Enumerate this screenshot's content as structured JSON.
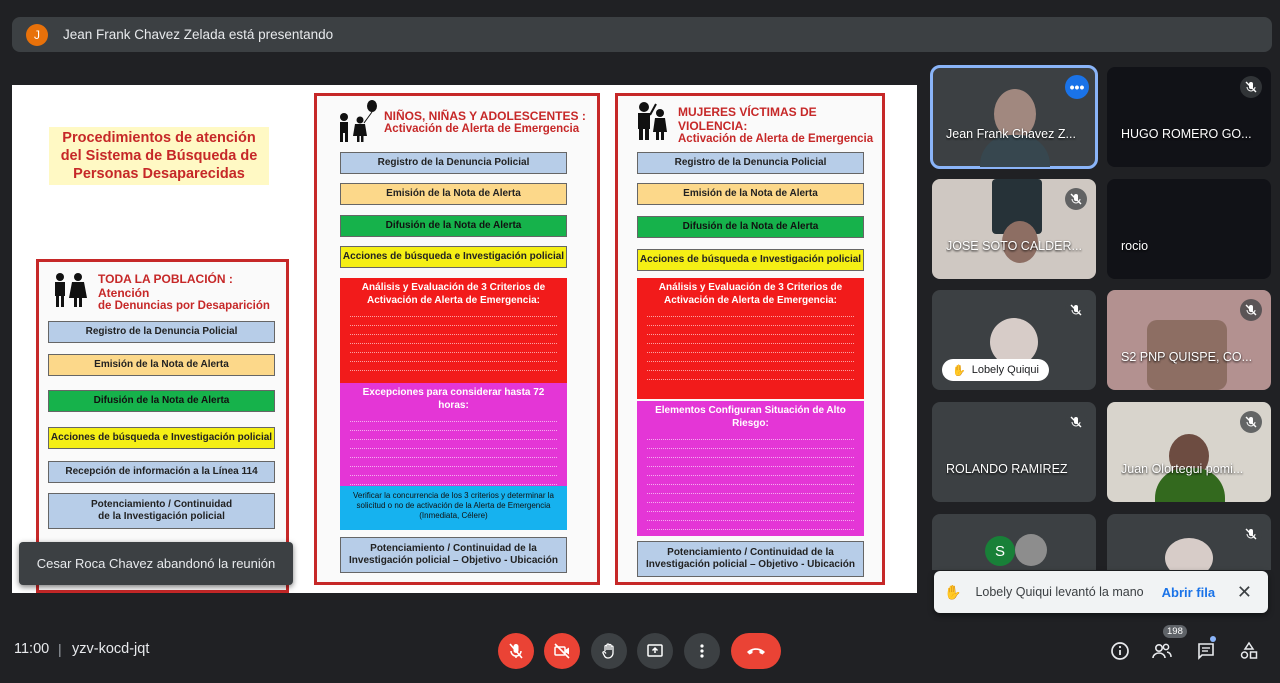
{
  "presenter": {
    "initial": "J",
    "text": "Jean Frank Chavez Zelada está presentando"
  },
  "slide": {
    "title": "Procedimientos de atención del Sistema de Búsqueda de Personas Desaparecidas",
    "col1": {
      "h1": "TODA LA POBLACIÓN : Atención",
      "h2": "de Denuncias por Desaparición",
      "steps": [
        "Registro de la Denuncia Policial",
        "Emisión de la Nota de Alerta",
        "Difusión de la Nota de Alerta",
        "Acciones de búsqueda e Investigación policial",
        "Recepción de información a la Línea 114",
        "Potenciamiento / Continuidad de la Investigación policial"
      ]
    },
    "col2": {
      "h1": "NIÑOS, NIÑAS Y ADOLESCENTES :",
      "h2": "Activación de Alerta de Emergencia",
      "steps": [
        "Registro de la Denuncia Policial",
        "Emisión de la Nota de Alerta",
        "Difusión de la Nota de Alerta",
        "Acciones de búsqueda e Investigación policial"
      ],
      "red_title": "Análisis y Evaluación de 3 Criterios de Activación de Alerta de Emergencia:",
      "magenta_title": "Excepciones para considerar hasta 72 horas:",
      "cyan_text": "Verificar la concurrencia de los 3 criterios y determinar la solicitud o no de activación de la Alerta de Emergencia (Inmediata, Célere)",
      "final": "Potenciamiento / Continuidad de la Investigación policial – Objetivo - Ubicación"
    },
    "col3": {
      "h1": "MUJERES VÍCTIMAS DE VIOLENCIA:",
      "h2": "Activación de Alerta de Emergencia",
      "steps": [
        "Registro de la Denuncia Policial",
        "Emisión de la Nota de Alerta",
        "Difusión de la Nota de Alerta",
        "Acciones de búsqueda e Investigación policial"
      ],
      "red_title": "Análisis y Evaluación de 3 Criterios de Activación de Alerta de Emergencia:",
      "magenta_title": "Elementos Configuran Situación de Alto Riesgo:",
      "final": "Potenciamiento / Continuidad de la Investigación policial – Objetivo - Ubicación"
    }
  },
  "toast_left": "Cesar Roca Chavez abandonó la reunión",
  "participants": [
    {
      "name": "Jean Frank Chavez Z..."
    },
    {
      "name": "HUGO ROMERO GO..."
    },
    {
      "name": "JOSE SOTO CALDER..."
    },
    {
      "name": "rocio"
    },
    {
      "name": "Lobely Quiqui"
    },
    {
      "name": "S2 PNP QUISPE, CO..."
    },
    {
      "name": "ROLANDO RAMIREZ"
    },
    {
      "name": "Juan Olortegui pomi..."
    },
    {
      "initial": "S"
    }
  ],
  "hand_toast": {
    "text": "Lobely Quiqui levantó la mano",
    "action": "Abrir fila"
  },
  "bottom": {
    "time": "11:00",
    "separator": "|",
    "code": "yzv-kocd-jqt",
    "people_count": "198"
  },
  "colors": {
    "accent": "#8ab4f8",
    "danger": "#ea4335",
    "bar": "#3c4043"
  }
}
